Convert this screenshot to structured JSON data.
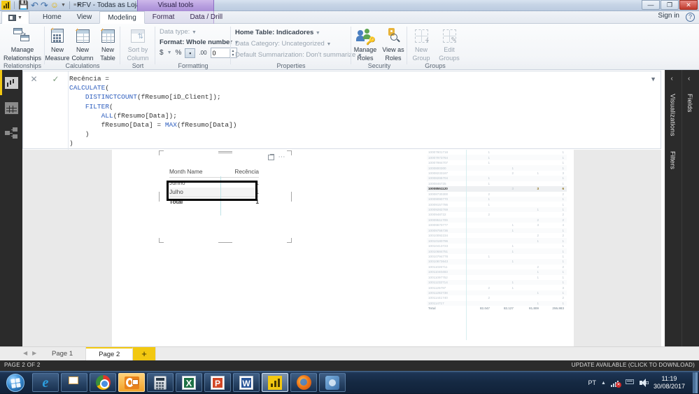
{
  "window": {
    "document_title": "RFV - Todas as Loja...",
    "contextual_tab_group": "Visual tools",
    "sign_in": "Sign in",
    "help_icon": "?",
    "minimize": "—",
    "maximize": "❐",
    "close": "✕"
  },
  "quick_access": {
    "app_logo": "powerbi-logo-icon",
    "save": "save-icon",
    "undo": "undo-icon",
    "redo": "redo-icon",
    "smiley": "smiley-feedback-icon",
    "dropdown": "customize-qat-icon"
  },
  "ribbon": {
    "file_menu": "file-menu-icon",
    "tabs": [
      {
        "label": "Home",
        "active": false,
        "contextual": false
      },
      {
        "label": "View",
        "active": false,
        "contextual": false
      },
      {
        "label": "Modeling",
        "active": true,
        "contextual": false
      },
      {
        "label": "Format",
        "active": false,
        "contextual": true
      },
      {
        "label": "Data / Drill",
        "active": false,
        "contextual": true
      }
    ],
    "groups": [
      {
        "name": "Relationships",
        "buttons": [
          {
            "label_line1": "Manage",
            "label_line2": "Relationships",
            "icon": "manage-relationships-icon"
          }
        ]
      },
      {
        "name": "Calculations",
        "buttons": [
          {
            "label_line1": "New",
            "label_line2": "Measure",
            "icon": "new-measure-icon"
          },
          {
            "label_line1": "New",
            "label_line2": "Column",
            "icon": "new-column-icon"
          },
          {
            "label_line1": "New",
            "label_line2": "Table",
            "icon": "new-table-icon"
          }
        ]
      },
      {
        "name": "Sort",
        "buttons": [
          {
            "label_line1": "Sort by",
            "label_line2": "Column",
            "icon": "sort-by-column-icon",
            "disabled": true
          }
        ]
      },
      {
        "name": "Formatting",
        "data_type_label": "Data type:",
        "format_label": "Format: Whole number",
        "currency_button": "$",
        "percent_button": "%",
        "comma_button": "comma-separator-icon",
        "decimal_button": "decimal-places-icon",
        "decimal_value": "0"
      },
      {
        "name": "Properties",
        "home_table": "Home Table: Indicadores",
        "data_category": "Data Category: Uncategorized",
        "default_summarization": "Default Summarization: Don't summarize"
      },
      {
        "name": "Security",
        "buttons": [
          {
            "label_line1": "Manage",
            "label_line2": "Roles",
            "icon": "manage-roles-icon"
          },
          {
            "label_line1": "View as",
            "label_line2": "Roles",
            "icon": "view-as-roles-icon"
          }
        ]
      },
      {
        "name": "Groups",
        "buttons": [
          {
            "label_line1": "New",
            "label_line2": "Group",
            "icon": "new-group-icon",
            "disabled": true
          },
          {
            "label_line1": "Edit",
            "label_line2": "Groups",
            "icon": "edit-groups-icon",
            "disabled": true
          }
        ]
      }
    ]
  },
  "formula_bar": {
    "cancel_icon": "cancel-icon",
    "accept_icon": "accept-checkmark-icon",
    "expand_icon": "expand-formula-bar-icon",
    "lines": [
      [
        {
          "t": "Recência =",
          "k": false
        }
      ],
      [
        {
          "t": "CALCULATE",
          "k": true
        },
        {
          "t": "(",
          "k": false
        }
      ],
      [
        {
          "t": "    ",
          "k": false
        },
        {
          "t": "DISTINCTCOUNT",
          "k": true
        },
        {
          "t": "(fResumo[iD_Client]);",
          "k": false
        }
      ],
      [
        {
          "t": "    ",
          "k": false
        },
        {
          "t": "FILTER",
          "k": true
        },
        {
          "t": "(",
          "k": false
        }
      ],
      [
        {
          "t": "        ",
          "k": false
        },
        {
          "t": "ALL",
          "k": true
        },
        {
          "t": "(fResumo[Data]);",
          "k": false
        }
      ],
      [
        {
          "t": "        fResumo[Data] = ",
          "k": false
        },
        {
          "t": "MAX",
          "k": true
        },
        {
          "t": "(fResumo[Data])",
          "k": false
        }
      ],
      [
        {
          "t": "    )",
          "k": false
        }
      ],
      [
        {
          "t": ")",
          "k": false
        }
      ]
    ]
  },
  "view_rail": {
    "items": [
      {
        "name": "report-view",
        "icon": "report-chart-icon",
        "active": true
      },
      {
        "name": "data-view",
        "icon": "data-grid-icon",
        "active": false
      },
      {
        "name": "relationships-view",
        "icon": "relationships-model-icon",
        "active": false
      }
    ]
  },
  "visual": {
    "focus_icon": "focus-mode-icon",
    "more_icon": "more-options-icon",
    "columns": [
      "Month Name",
      "Recência"
    ],
    "rows": [
      {
        "month": "Junho",
        "value": "1"
      },
      {
        "month": "Julho",
        "value": "1"
      }
    ],
    "total": {
      "label": "Total",
      "value": "1"
    },
    "highlight": "black-annotation-box"
  },
  "background_table": {
    "total_label": "Total",
    "total_values": [
      "82.047",
      "82.127",
      "91.809",
      "255.983"
    ],
    "rows": [
      {
        "id": "10007801718",
        "c1": "1",
        "c2": "",
        "c3": "",
        "c4": "1"
      },
      {
        "id": "10007973764",
        "c1": "1",
        "c2": "",
        "c3": "",
        "c4": "1"
      },
      {
        "id": "10007984707",
        "c1": "1",
        "c2": "",
        "c3": "",
        "c4": "1"
      },
      {
        "id": "1000800300",
        "c1": "",
        "c2": "1",
        "c3": "",
        "c4": "1"
      },
      {
        "id": "10008233187",
        "c1": "",
        "c2": "2",
        "c3": "1",
        "c4": "3"
      },
      {
        "id": "10008265704",
        "c1": "1",
        "c2": "",
        "c3": "",
        "c4": "1"
      },
      {
        "id": "1000846725",
        "c1": "1",
        "c2": "",
        "c3": "",
        "c4": "1"
      },
      {
        "id": "10008551120",
        "c1": "",
        "c2": "3",
        "c3": "3",
        "c4": "6",
        "selected": true
      },
      {
        "id": "10008730300",
        "c1": "2",
        "c2": "",
        "c3": "",
        "c4": "2"
      },
      {
        "id": "10009090770",
        "c1": "1",
        "c2": "",
        "c3": "",
        "c4": "1"
      },
      {
        "id": "10009157786",
        "c1": "1",
        "c2": "",
        "c3": "",
        "c4": "1"
      },
      {
        "id": "10009282769",
        "c1": "",
        "c2": "",
        "c3": "1",
        "c4": "1"
      },
      {
        "id": "1000948722",
        "c1": "2",
        "c2": "",
        "c3": "",
        "c4": "2"
      },
      {
        "id": "10009511709",
        "c1": "",
        "c2": "",
        "c3": "2",
        "c4": "2"
      },
      {
        "id": "10009670777",
        "c1": "",
        "c2": "1",
        "c3": "3",
        "c4": "4"
      },
      {
        "id": "10009756736",
        "c1": "",
        "c2": "1",
        "c3": "",
        "c4": "1"
      },
      {
        "id": "10010092234",
        "c1": "",
        "c2": "",
        "c3": "2",
        "c4": "2"
      },
      {
        "id": "10010180796",
        "c1": "",
        "c2": "",
        "c3": "1",
        "c4": "1"
      },
      {
        "id": "10010413723",
        "c1": "",
        "c2": "1",
        "c3": "",
        "c4": "1"
      },
      {
        "id": "10010684751",
        "c1": "",
        "c2": "1",
        "c3": "",
        "c4": "1"
      },
      {
        "id": "10010794778",
        "c1": "1",
        "c2": "",
        "c3": "",
        "c4": "1"
      },
      {
        "id": "10010873643",
        "c1": "",
        "c2": "1",
        "c3": "",
        "c4": "1"
      },
      {
        "id": "10011026711",
        "c1": "",
        "c2": "",
        "c3": "2",
        "c4": "2"
      },
      {
        "id": "10011040483",
        "c1": "",
        "c2": "",
        "c3": "1",
        "c4": "1"
      },
      {
        "id": "10011097752",
        "c1": "",
        "c2": "",
        "c3": "1",
        "c4": "1"
      },
      {
        "id": "10011232714",
        "c1": "",
        "c2": "1",
        "c3": "",
        "c4": "1"
      },
      {
        "id": "1001125797",
        "c1": "2",
        "c2": "1",
        "c3": "",
        "c4": "3"
      },
      {
        "id": "10011282738",
        "c1": "",
        "c2": "",
        "c3": "1",
        "c4": "1"
      },
      {
        "id": "10011441740",
        "c1": "2",
        "c2": "",
        "c3": "",
        "c4": "2"
      },
      {
        "id": "100114717",
        "c1": "",
        "c2": "",
        "c3": "1",
        "c4": "1"
      }
    ]
  },
  "panes": {
    "visualizations": {
      "label": "Visualizations",
      "collapse_icon": "chevron-left-icon"
    },
    "filters": {
      "label": "Filters"
    },
    "fields": {
      "label": "Fields",
      "collapse_icon": "chevron-left-icon"
    }
  },
  "page_tabs": {
    "prev_icon": "prev-page-icon",
    "next_icon": "next-page-icon",
    "tabs": [
      {
        "label": "Page 1",
        "active": false
      },
      {
        "label": "Page 2",
        "active": true
      }
    ],
    "add_label": "+"
  },
  "status_bar": {
    "page_indicator": "PAGE 2 OF 2",
    "update_notice": "UPDATE AVAILABLE (CLICK TO DOWNLOAD)"
  },
  "taskbar": {
    "start": "windows-start-icon",
    "apps": [
      {
        "name": "internet-explorer",
        "icon": "internet-explorer-icon"
      },
      {
        "name": "file-explorer",
        "icon": "file-explorer-icon"
      },
      {
        "name": "google-chrome",
        "icon": "chrome-icon"
      },
      {
        "name": "microsoft-outlook",
        "icon": "outlook-icon"
      },
      {
        "name": "calculator",
        "icon": "calculator-icon"
      },
      {
        "name": "microsoft-excel",
        "icon": "excel-icon"
      },
      {
        "name": "microsoft-powerpoint",
        "icon": "powerpoint-icon"
      },
      {
        "name": "microsoft-word",
        "icon": "word-icon"
      },
      {
        "name": "power-bi-desktop",
        "icon": "power-bi-icon"
      },
      {
        "name": "mozilla-firefox",
        "icon": "firefox-icon"
      },
      {
        "name": "other-app",
        "icon": "generic-app-icon"
      }
    ],
    "tray": {
      "language": "PT",
      "show_hidden": "show-hidden-icons-icon",
      "network": "network-disconnected-icon",
      "action_center": "action-center-icon",
      "volume": "volume-icon",
      "time": "11:19",
      "date": "30/08/2017"
    }
  }
}
